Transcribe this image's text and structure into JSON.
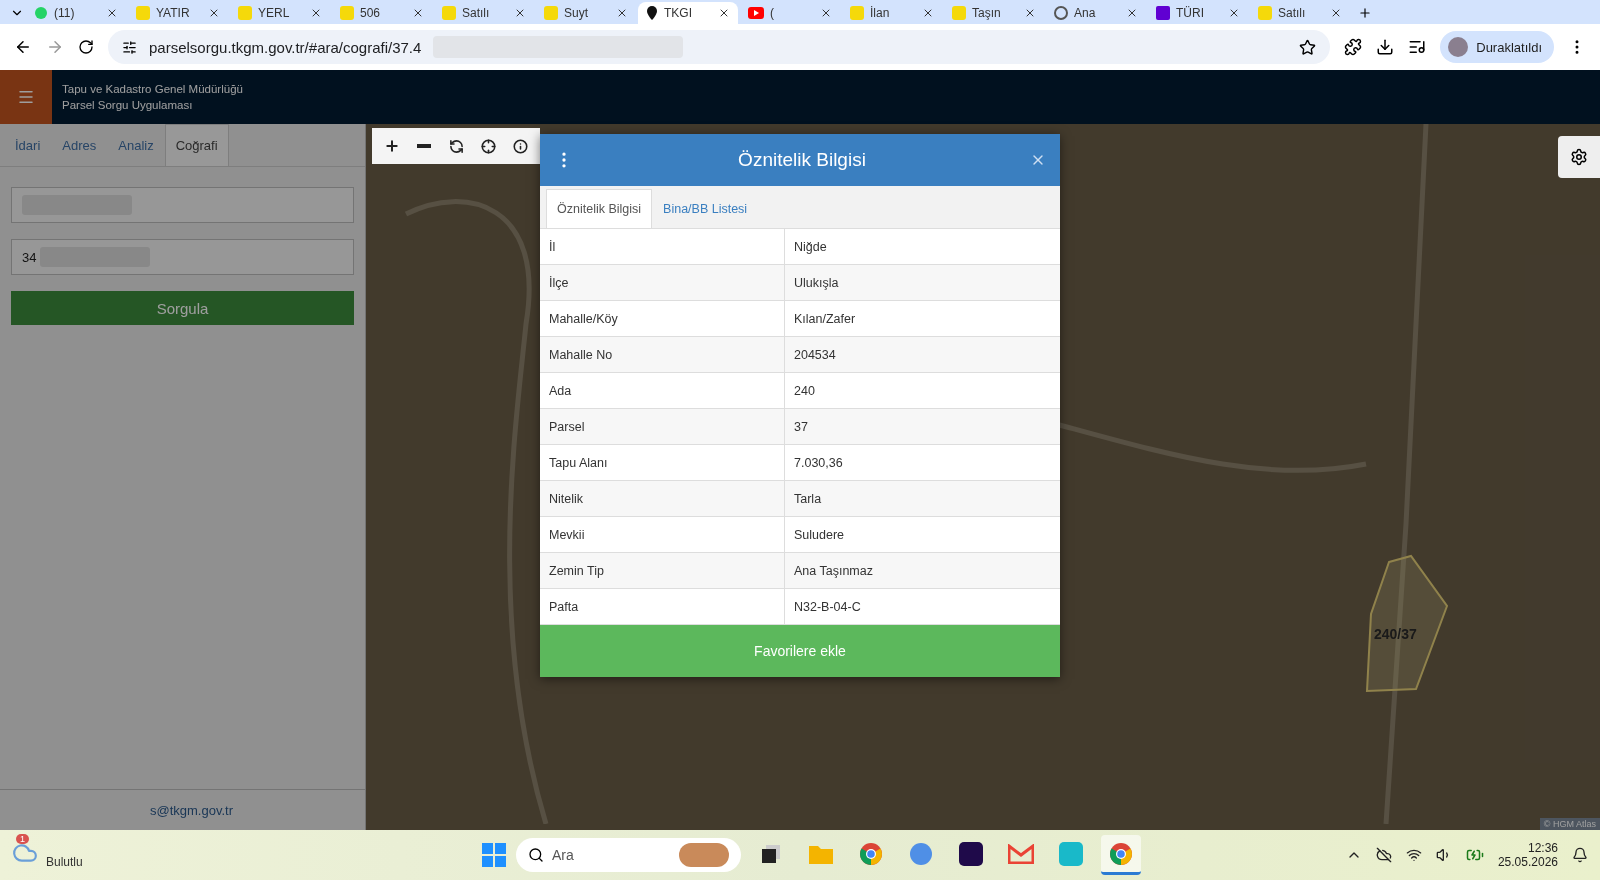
{
  "browser": {
    "tabs": [
      {
        "kind": "chat",
        "title": "(11)",
        "selected": false
      },
      {
        "kind": "letter",
        "title": "YATIR",
        "selected": false
      },
      {
        "kind": "letter",
        "title": "YERL",
        "selected": false
      },
      {
        "kind": "letter",
        "title": "506",
        "selected": false
      },
      {
        "kind": "letter",
        "title": "Satılı",
        "selected": false
      },
      {
        "kind": "letter",
        "title": "Suyt",
        "selected": false
      },
      {
        "kind": "pin",
        "title": "TKGI",
        "selected": true
      },
      {
        "kind": "video",
        "title": "(",
        "selected": false
      },
      {
        "kind": "letter",
        "title": "İlan",
        "selected": false
      },
      {
        "kind": "letter",
        "title": "Taşın",
        "selected": false
      },
      {
        "kind": "globe",
        "title": "Ana",
        "selected": false
      },
      {
        "kind": "mail",
        "title": "TÜRI",
        "selected": false
      },
      {
        "kind": "letter",
        "title": "Satılı",
        "selected": false
      }
    ],
    "address": "parselsorgu.tkgm.gov.tr/#ara/cografi/37.4",
    "profile": "Duraklatıldı"
  },
  "app": {
    "title_lines": [
      "Tapu ve Kadastro Genel Müdürlüğü",
      "Parsel Sorgu Uygulaması"
    ],
    "side_tabs": [
      {
        "label": "İdari",
        "selected": false
      },
      {
        "label": "Adres",
        "selected": false
      },
      {
        "label": "Analiz",
        "selected": false
      },
      {
        "label": "Coğrafi",
        "selected": true
      }
    ],
    "fields": [
      {
        "blurred": true
      },
      {
        "value": "34",
        "blurred": true
      }
    ],
    "query_button": "Sorgula",
    "contact": "s@tkgm.gov.tr"
  },
  "map": {
    "parcel_label": "240/37",
    "attribution": "© HGM Atlas"
  },
  "dialog": {
    "title": "Öznitelik Bilgisi",
    "tabs": [
      {
        "label": "Öznitelik Bilgisi",
        "selected": true
      },
      {
        "label": "Bina/BB Listesi",
        "selected": false
      }
    ],
    "rows": [
      {
        "label": "İl",
        "value": "Niğde"
      },
      {
        "label": "İlçe",
        "value": "Ulukışla"
      },
      {
        "label": "Mahalle/Köy",
        "value": "Kılan/Zafer"
      },
      {
        "label": "Mahalle No",
        "value": "204534"
      },
      {
        "label": "Ada",
        "value": "240"
      },
      {
        "label": "Parsel",
        "value": "37"
      },
      {
        "label": "Tapu Alanı",
        "value": "7.030,36"
      },
      {
        "label": "Nitelik",
        "value": "Tarla"
      },
      {
        "label": "Mevkii",
        "value": "Suludere"
      },
      {
        "label": "Zemin Tip",
        "value": "Ana Taşınmaz"
      },
      {
        "label": "Pafta",
        "value": "N32-B-04-C"
      }
    ],
    "button": "Favorilere ekle"
  },
  "taskbar": {
    "weather_badge": "1",
    "weather": "Bulutlu",
    "search_placeholder": "Ara",
    "apps": [
      {
        "kind": "taskview",
        "active": false
      },
      {
        "kind": "folder",
        "active": false
      },
      {
        "kind": "chrome",
        "active": false
      },
      {
        "kind": "sphere",
        "active": false
      },
      {
        "kind": "ae",
        "active": false
      },
      {
        "kind": "gmail",
        "active": false
      },
      {
        "kind": "canva",
        "active": false
      },
      {
        "kind": "chrome",
        "active": true
      }
    ],
    "time": "12:36",
    "date": "25.05.2026"
  }
}
